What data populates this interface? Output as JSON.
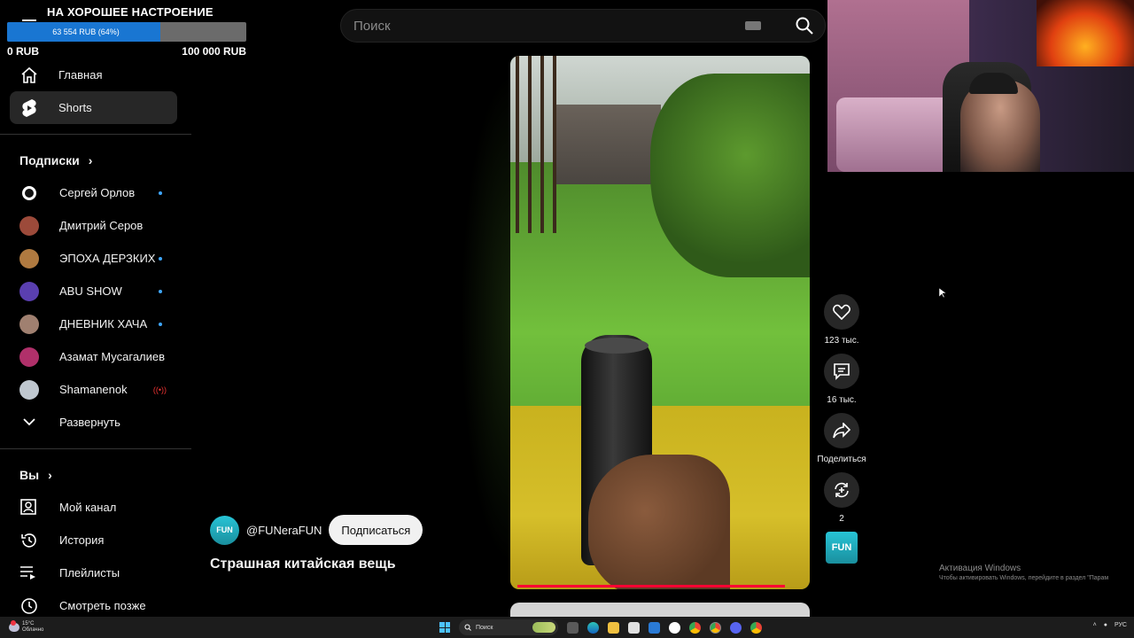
{
  "donation": {
    "title": "НА ХОРОШЕЕ НАСТРОЕНИЕ",
    "bar_text": "63 554 RUB (64%)",
    "progress": 0.64,
    "min_label": "0 RUB",
    "max_label": "100 000 RUB"
  },
  "search": {
    "placeholder": "Поиск"
  },
  "sidebar": {
    "main": [
      {
        "label": "Главная",
        "icon": "home-icon"
      },
      {
        "label": "Shorts",
        "icon": "shorts-icon",
        "active": true
      }
    ],
    "subscriptions_title": "Подписки",
    "subscriptions": [
      {
        "label": "Сергей Орлов",
        "dot": true,
        "color": "#111111"
      },
      {
        "label": "Дмитрий Серов",
        "dot": false,
        "color": "#9c4a3a"
      },
      {
        "label": "ЭПОХА ДЕРЗКИХ",
        "dot": true,
        "color": "#b07a40"
      },
      {
        "label": "ABU SHOW",
        "dot": true,
        "color": "#5a3fb0"
      },
      {
        "label": "ДНЕВНИК ХАЧА",
        "dot": true,
        "color": "#a08070"
      },
      {
        "label": "Азамат Мусагалиев",
        "dot": false,
        "color": "#b0306a"
      },
      {
        "label": "Shamanenok",
        "live": true,
        "color": "#c0c8d0"
      }
    ],
    "expand_label": "Развернуть",
    "you_title": "Вы",
    "you": [
      {
        "label": "Мой канал",
        "icon": "person-icon"
      },
      {
        "label": "История",
        "icon": "history-icon"
      },
      {
        "label": "Плейлисты",
        "icon": "playlist-icon"
      },
      {
        "label": "Смотреть позже",
        "icon": "clock-icon"
      }
    ]
  },
  "short": {
    "channel_handle": "@FUNeraFUN",
    "subscribe_label": "Подписаться",
    "title": "Страшная китайская вещь",
    "channel_avatar_text": "FUN"
  },
  "actions": {
    "likes": "123 тыс.",
    "comments": "16 тыс.",
    "share": "Поделиться",
    "remix": "2"
  },
  "activation": {
    "line1": "Активация Windows",
    "line2": "Чтобы активировать Windows, перейдите в раздел \"Парам"
  },
  "taskbar": {
    "weather_temp": "15°C",
    "weather_desc": "Облачно",
    "search_label": "Поиск",
    "lang": "РУС"
  },
  "colors": {
    "accent": "#ff0033",
    "link_dot": "#3ea6ff",
    "progress_fill": "#1976d2"
  }
}
